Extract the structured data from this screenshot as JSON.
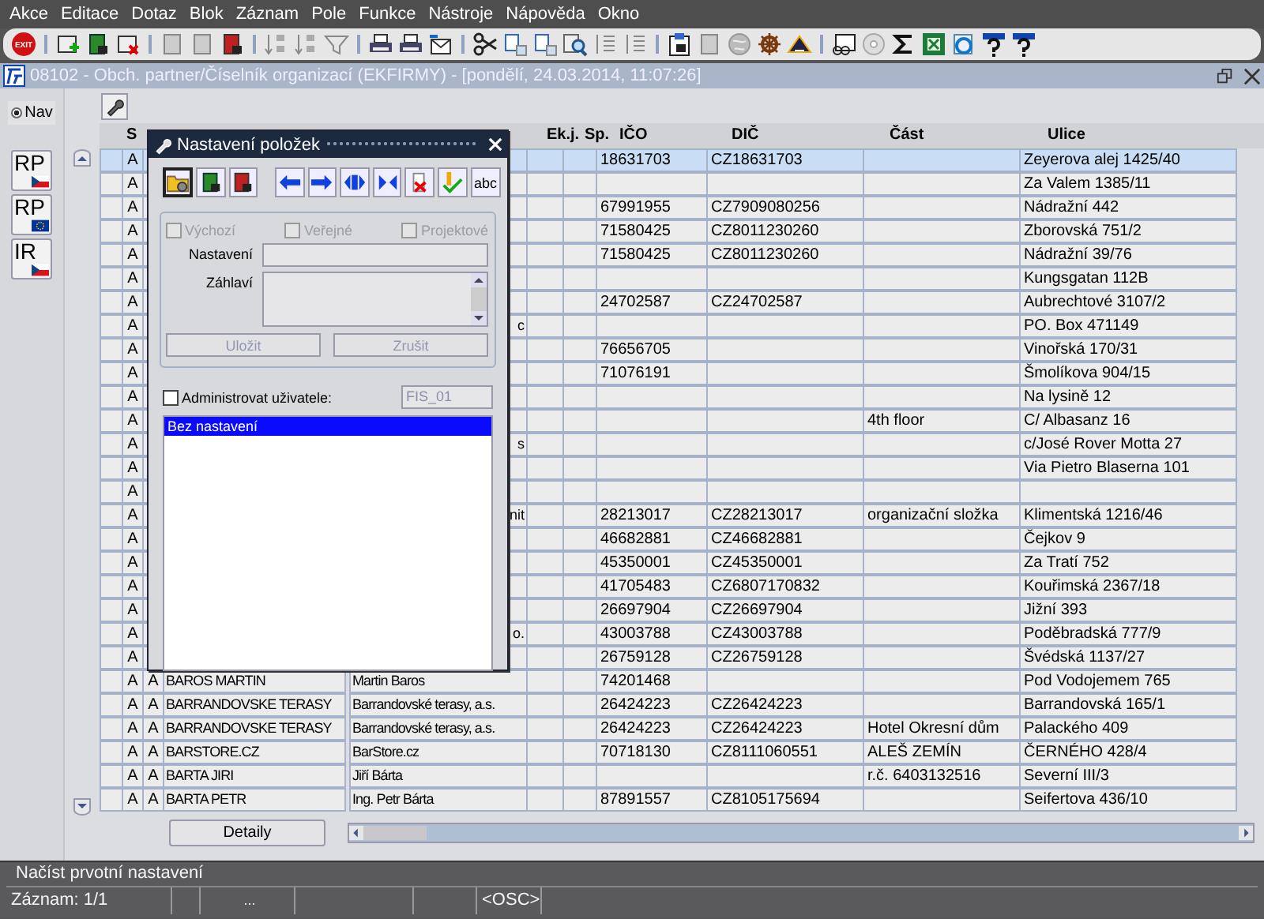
{
  "menu": [
    "Akce",
    "Editace",
    "Dotaz",
    "Blok",
    "Záznam",
    "Pole",
    "Funkce",
    "Nástroje",
    "Nápověda",
    "Okno"
  ],
  "toolbar": {
    "exit_label": "EXIT"
  },
  "window": {
    "title": "08102 - Obch. partner/Číselník organizací (EKFIRMY) - [pondělí, 24.03.2014, 11:07:26]"
  },
  "nav": {
    "label": "Nav",
    "selected": true
  },
  "side_buttons": [
    {
      "label": "RP",
      "kind": "cz"
    },
    {
      "label": "RP",
      "kind": "eu"
    },
    {
      "label": "IR",
      "kind": "cz"
    }
  ],
  "table": {
    "columns": [
      "S",
      "Ek.j.",
      "Sp.",
      "IČO",
      "DIČ",
      "Část",
      "Ulice"
    ],
    "rows": [
      {
        "selected": true,
        "s": "A",
        "ico": "18631703",
        "dic": "CZ18631703",
        "ulice": "Zeyerova alej 1425/40"
      },
      {
        "selected": false,
        "s": "A",
        "ulice": "Za Valem 1385/11"
      },
      {
        "selected": false,
        "s": "A",
        "ico": "67991955",
        "dic": "CZ7909080256",
        "ulice": "Nádražní 442"
      },
      {
        "selected": false,
        "s": "A",
        "ico": "71580425",
        "dic": "CZ8011230260",
        "ulice": "Zborovská 751/2"
      },
      {
        "selected": false,
        "s": "A",
        "ico": "71580425",
        "dic": "CZ8011230260",
        "ulice": "Nádražní 39/76"
      },
      {
        "selected": false,
        "s": "A",
        "ulice": "Kungsgatan 112B"
      },
      {
        "selected": false,
        "s": "A",
        "ico": "24702587",
        "dic": "CZ24702587",
        "ulice": "Aubrechtové 3107/2"
      },
      {
        "selected": false,
        "s": "A",
        "tail": "c",
        "ulice": "PO. Box 471149"
      },
      {
        "selected": false,
        "s": "A",
        "ico": "76656705",
        "ulice": "Vinořská 170/31"
      },
      {
        "selected": false,
        "s": "A",
        "ico": "71076191",
        "ulice": "Šmolíkova 904/15"
      },
      {
        "selected": false,
        "s": "A",
        "ulice": "Na lysině 12"
      },
      {
        "selected": false,
        "s": "A",
        "cast": "4th floor",
        "ulice": "C/ Albasanz 16"
      },
      {
        "selected": false,
        "s": "A",
        "tail": "s",
        "ulice": "c/José Rover Motta 27"
      },
      {
        "selected": false,
        "s": "A",
        "ulice": "Via Pietro Blaserna 101"
      },
      {
        "selected": false,
        "s": "A"
      },
      {
        "selected": false,
        "s": "A",
        "tail": "nit",
        "ico": "28213017",
        "dic": "CZ28213017",
        "cast": "organizační složka",
        "ulice": "Klimentská 1216/46"
      },
      {
        "selected": false,
        "s": "A",
        "ico": "46682881",
        "dic": "CZ46682881",
        "ulice": "Čejkov 9"
      },
      {
        "selected": false,
        "s": "A",
        "ico": "45350001",
        "dic": "CZ45350001",
        "ulice": "Za Tratí 752"
      },
      {
        "selected": false,
        "s": "A",
        "ico": "41705483",
        "dic": "CZ6807170832",
        "ulice": "Kouřimská 2367/18"
      },
      {
        "selected": false,
        "s": "A",
        "ico": "26697904",
        "dic": "CZ26697904",
        "ulice": "Jižní 393"
      },
      {
        "selected": false,
        "s": "A",
        "tail": "o.",
        "ico": "43003788",
        "dic": "CZ43003788",
        "ulice": "Poděbradská 777/9"
      },
      {
        "selected": false,
        "s": "A",
        "ico": "26759128",
        "dic": "CZ26759128",
        "ulice": "Švédská 1137/27"
      },
      {
        "selected": false,
        "s": "A",
        "a2": "A",
        "name": "BAROS MARTIN",
        "name2": "Martin Baros",
        "ico": "74201468",
        "ulice": "Pod Vodojemem 765"
      },
      {
        "selected": false,
        "s": "A",
        "a2": "A",
        "name": "BARRANDOVSKE TERASY",
        "name2": "Barrandovské terasy, a.s.",
        "ico": "26424223",
        "dic": "CZ26424223",
        "ulice": "Barrandovská 165/1"
      },
      {
        "selected": false,
        "s": "A",
        "a2": "A",
        "name": "BARRANDOVSKE TERASY",
        "name2": "Barrandovské terasy, a.s.",
        "ico": "26424223",
        "dic": "CZ26424223",
        "cast": "Hotel Okresní dům",
        "ulice": "Palackého 409"
      },
      {
        "selected": false,
        "s": "A",
        "a2": "A",
        "name": "BARSTORE.CZ",
        "name2": "BarStore.cz",
        "ico": "70718130",
        "dic": "CZ8111060551",
        "cast": "ALEŠ ZEMÍN",
        "ulice": "ČERNÉHO 428/4"
      },
      {
        "selected": false,
        "s": "A",
        "a2": "A",
        "name": "BARTA JIRI",
        "name2": "Jiří Bárta",
        "cast": "r.č. 6403132516",
        "ulice": "Severní III/3"
      },
      {
        "selected": false,
        "s": "A",
        "a2": "A",
        "name": "BARTA PETR",
        "name2": "Ing. Petr Bárta",
        "ico": "87891557",
        "dic": "CZ8105175694",
        "ulice": "Seifertova 436/10"
      }
    ]
  },
  "details_button": "Detaily",
  "dialog": {
    "title": "Nastavení položek",
    "tool_text": "abc",
    "checkboxes": [
      {
        "label": "Výchozí",
        "checked": false,
        "disabled": true
      },
      {
        "label": "Veřejné",
        "checked": false,
        "disabled": true
      },
      {
        "label": "Projektové",
        "checked": false,
        "disabled": true
      }
    ],
    "setting_label": "Nastavení",
    "header_label": "Záhlaví",
    "buttons": [
      {
        "label": "Uložit",
        "disabled": true
      },
      {
        "label": "Zrušit",
        "disabled": true
      }
    ],
    "admin": {
      "label": "Administrovat uživatele:",
      "checked": false
    },
    "user_value": "FIS_01",
    "list": [
      {
        "label": "Bez nastavení",
        "selected": true
      }
    ]
  },
  "status": {
    "message": "Načíst prvotní nastavení",
    "record": "Záznam: 1/1",
    "ellipsis": "...",
    "mode": "<OSC>"
  }
}
